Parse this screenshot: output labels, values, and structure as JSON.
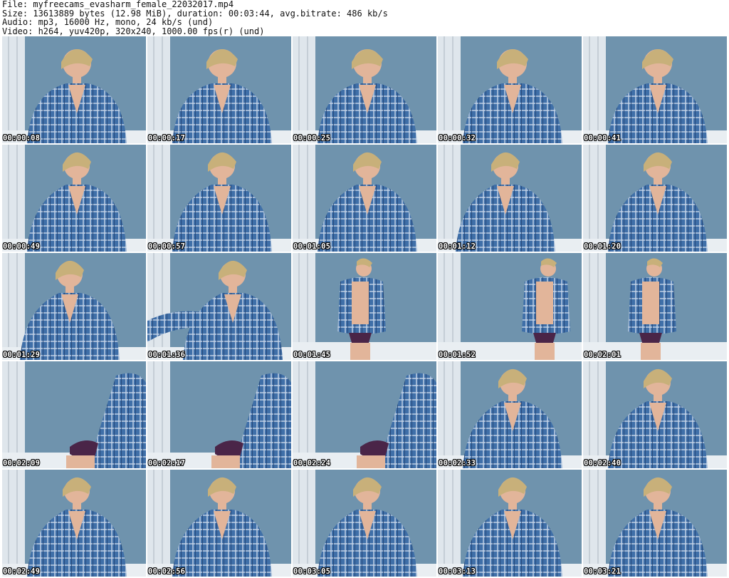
{
  "header": {
    "file_line": "File: myfreecams_evasharm_female_22032017.mp4",
    "size_line": "Size: 13613889 bytes (12.98 MiB), duration: 00:03:44, avg.bitrate: 486 kb/s",
    "audio_line": "Audio: mp3, 16000 Hz, mono, 24 kb/s (und)",
    "video_line": "Video: h264, yuv420p, 320x240, 1000.00 fps(r) (und)"
  },
  "thumbnails": [
    {
      "timestamp": "00:00:08",
      "scene": "seated-close"
    },
    {
      "timestamp": "00:00:17",
      "scene": "seated-close"
    },
    {
      "timestamp": "00:00:25",
      "scene": "seated-close"
    },
    {
      "timestamp": "00:00:32",
      "scene": "seated-close"
    },
    {
      "timestamp": "00:00:41",
      "scene": "seated-close"
    },
    {
      "timestamp": "00:00:49",
      "scene": "seated"
    },
    {
      "timestamp": "00:00:57",
      "scene": "seated"
    },
    {
      "timestamp": "00:01:05",
      "scene": "seated"
    },
    {
      "timestamp": "00:01:12",
      "scene": "seated-lean"
    },
    {
      "timestamp": "00:01:20",
      "scene": "seated"
    },
    {
      "timestamp": "00:01:29",
      "scene": "seated-lean"
    },
    {
      "timestamp": "00:01:36",
      "scene": "reaching"
    },
    {
      "timestamp": "00:01:45",
      "scene": "standing"
    },
    {
      "timestamp": "00:01:52",
      "scene": "standing-side"
    },
    {
      "timestamp": "00:02:01",
      "scene": "standing"
    },
    {
      "timestamp": "00:02:09",
      "scene": "bending"
    },
    {
      "timestamp": "00:02:17",
      "scene": "bending"
    },
    {
      "timestamp": "00:02:24",
      "scene": "bending"
    },
    {
      "timestamp": "00:02:33",
      "scene": "seated"
    },
    {
      "timestamp": "00:02:40",
      "scene": "seated"
    },
    {
      "timestamp": "00:02:49",
      "scene": "seated"
    },
    {
      "timestamp": "00:02:56",
      "scene": "seated"
    },
    {
      "timestamp": "00:03:05",
      "scene": "seated"
    },
    {
      "timestamp": "00:03:13",
      "scene": "seated"
    },
    {
      "timestamp": "00:03:21",
      "scene": "seated"
    }
  ],
  "colors": {
    "wall": "#6f93ad",
    "curtain": "#dfe6ec",
    "shirt": "#3f6fa8",
    "shirt_check": "#c9d8ea",
    "skin": "#e2b59a",
    "hair": "#c8b07a",
    "floor": "#e9eef2"
  }
}
